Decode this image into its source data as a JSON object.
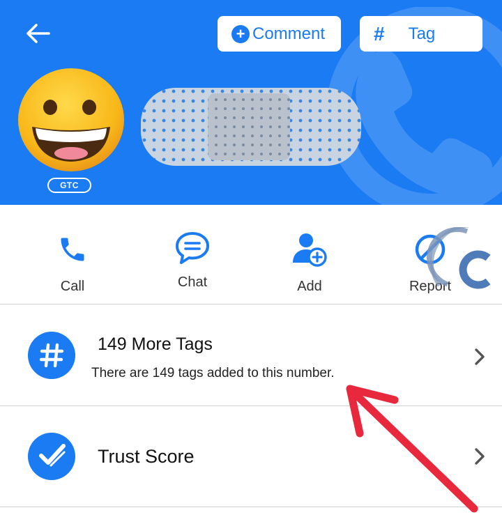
{
  "header": {
    "comment_label": "Comment",
    "tag_label": "Tag",
    "badge": "GTC"
  },
  "actions": [
    {
      "label": "Call",
      "icon": "phone-icon"
    },
    {
      "label": "Chat",
      "icon": "chat-bubble-icon"
    },
    {
      "label": "Add",
      "icon": "add-contact-icon"
    },
    {
      "label": "Report",
      "icon": "block-icon"
    }
  ],
  "tags_row": {
    "title": "149 More Tags",
    "subtitle": "There are 149 tags added to this number.",
    "icon": "hash-icon"
  },
  "trust_row": {
    "title": "Trust Score",
    "icon": "check-badge-icon"
  },
  "colors": {
    "brand": "#1a7bf2",
    "annotation": "#e8283c"
  }
}
